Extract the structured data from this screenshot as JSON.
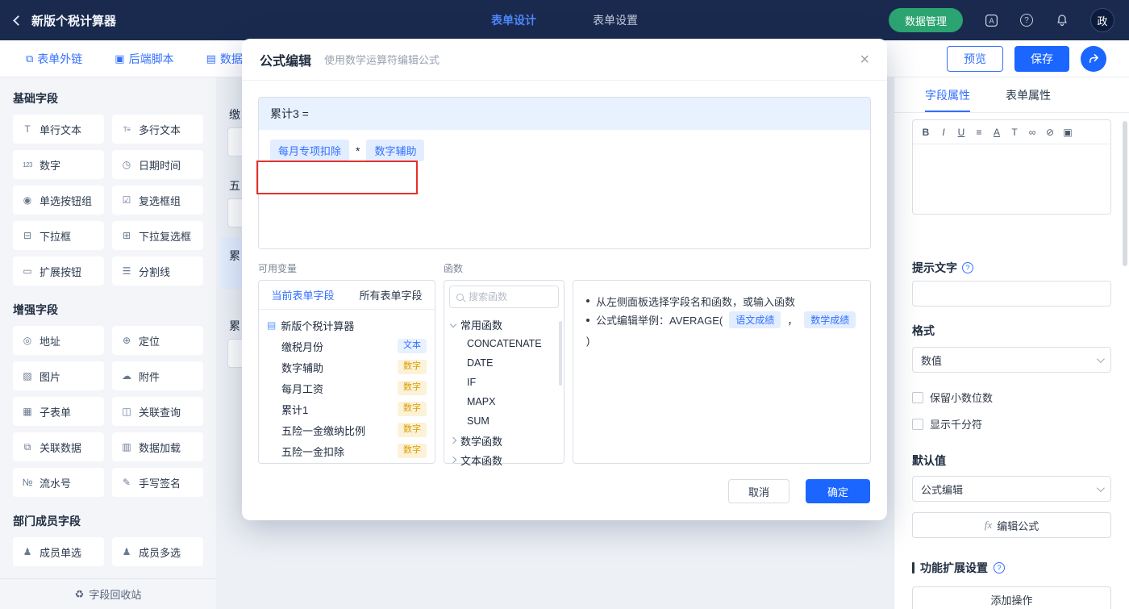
{
  "header": {
    "title": "新版个税计算器",
    "nav": [
      {
        "label": "表单设计"
      },
      {
        "label": "表单设置"
      }
    ],
    "data_manage_label": "数据管理",
    "avatar_text": "政"
  },
  "toolbar": {
    "links": [
      {
        "label": "表单外链",
        "glyph": "⧉"
      },
      {
        "label": "后端脚本",
        "glyph": "▣"
      },
      {
        "label": "数据权",
        "glyph": "▤"
      }
    ],
    "preview_label": "预览",
    "save_label": "保存"
  },
  "sidebar": {
    "sections": [
      {
        "title": "基础字段",
        "items": [
          {
            "label": "单行文本",
            "glyph": "T"
          },
          {
            "label": "多行文本",
            "glyph": "T≡"
          },
          {
            "label": "数字",
            "glyph": "123"
          },
          {
            "label": "日期时间",
            "glyph": "◷"
          },
          {
            "label": "单选按钮组",
            "glyph": "◉"
          },
          {
            "label": "复选框组",
            "glyph": "☑"
          },
          {
            "label": "下拉框",
            "glyph": "⊟"
          },
          {
            "label": "下拉复选框",
            "glyph": "⊞"
          },
          {
            "label": "扩展按钮",
            "glyph": "▭"
          },
          {
            "label": "分割线",
            "glyph": "☰"
          }
        ]
      },
      {
        "title": "增强字段",
        "items": [
          {
            "label": "地址",
            "glyph": "◎"
          },
          {
            "label": "定位",
            "glyph": "⊕"
          },
          {
            "label": "图片",
            "glyph": "▨"
          },
          {
            "label": "附件",
            "glyph": "☁"
          },
          {
            "label": "子表单",
            "glyph": "▦"
          },
          {
            "label": "关联查询",
            "glyph": "◫"
          },
          {
            "label": "关联数据",
            "glyph": "⧉"
          },
          {
            "label": "数据加载",
            "glyph": "▥"
          },
          {
            "label": "流水号",
            "glyph": "№"
          },
          {
            "label": "手写签名",
            "glyph": "✎"
          }
        ]
      },
      {
        "title": "部门成员字段",
        "items": [
          {
            "label": "成员单选",
            "glyph": "♟"
          },
          {
            "label": "成员多选",
            "glyph": "♟"
          }
        ]
      }
    ],
    "recycle_label": "字段回收站",
    "recycle_glyph": "♻"
  },
  "canvas": {
    "clipped_labels": [
      "缴",
      "五",
      "累",
      "累"
    ]
  },
  "modal": {
    "title": "公式编辑",
    "subtitle": "使用数学运算符编辑公式",
    "close_glyph": "×",
    "formula": {
      "target": "累计3 =",
      "operand1": "每月专项扣除",
      "operator": "*",
      "operand2": "数字辅助"
    },
    "variables": {
      "label": "可用变量",
      "tabs": [
        {
          "label": "当前表单字段"
        },
        {
          "label": "所有表单字段"
        }
      ],
      "root": "新版个税计算器",
      "root_glyph": "▤",
      "fields": [
        {
          "name": "缴税月份",
          "type": "文本"
        },
        {
          "name": "数字辅助",
          "type": "数字"
        },
        {
          "name": "每月工资",
          "type": "数字"
        },
        {
          "name": "累计1",
          "type": "数字"
        },
        {
          "name": "五险一金缴纳比例",
          "type": "数字"
        },
        {
          "name": "五险一金扣除",
          "type": "数字"
        }
      ]
    },
    "functions": {
      "label": "函数",
      "search_placeholder": "搜索函数",
      "group_expanded": "常用函数",
      "items": [
        "CONCATENATE",
        "DATE",
        "IF",
        "MAPX",
        "SUM"
      ],
      "groups_collapsed": [
        "数学函数",
        "文本函数"
      ]
    },
    "help": {
      "line1": "从左侧面板选择字段名和函数，或输入函数",
      "line2_prefix": "公式编辑举例：AVERAGE(",
      "example_field1": "语文成绩",
      "line2_sep": "，",
      "example_field2": "数学成绩",
      "line2_suffix": ")"
    },
    "cancel_label": "取消",
    "confirm_label": "确定"
  },
  "panel": {
    "tabs": [
      {
        "label": "字段属性"
      },
      {
        "label": "表单属性"
      }
    ],
    "editor_icons": [
      "B",
      "I",
      "U",
      "≡",
      "A",
      "T",
      "∞",
      "⊘",
      "▣"
    ],
    "hint_label": "提示文字",
    "format_label": "格式",
    "format_value": "数值",
    "checkbox1": "保留小数位数",
    "checkbox2": "显示千分符",
    "default_label": "默认值",
    "default_value": "公式编辑",
    "fx_prefix": "fx",
    "fx_button": "编辑公式",
    "ext_section": "功能扩展设置",
    "add_action": "添加操作",
    "help_glyph": "?"
  },
  "colors": {
    "accent": "#3370ff",
    "primary_button": "#1a66ff",
    "green_button": "#2ba471",
    "header_bg": "#1a2a4e",
    "annotation_red": "#e5312b",
    "tag_text_bg": "#e8f1ff",
    "tag_text_color": "#3370ff",
    "tag_number_bg": "#fcf2d7",
    "tag_number_color": "#dd9d00"
  }
}
